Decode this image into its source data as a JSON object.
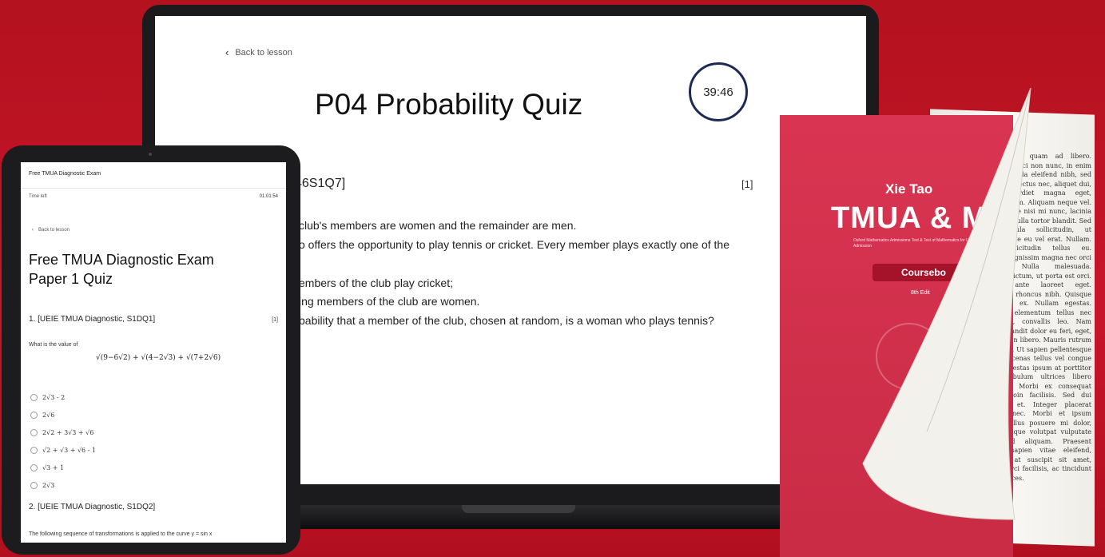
{
  "laptop": {
    "back_label": "Back to lesson",
    "title": "P04 Probability Quiz",
    "timer": "39:46",
    "question_header": "46S1Q7]",
    "mark": "[1]",
    "lines": [
      "club's members are women and the remainder are men.",
      "o offers the opportunity to play tennis or cricket. Every member plays exactly one of the",
      "embers of the club play cricket;",
      "ing members of the club are women.",
      "bability that a member of the club, chosen at random, is a woman who plays tennis?"
    ]
  },
  "tablet": {
    "app_title": "Free TMUA Diagnostic Exam",
    "time_left_label": "Time left",
    "time_left_value": "01:01:54",
    "back_label": "Back to lesson",
    "title_line1": "Free TMUA Diagnostic Exam",
    "title_line2": "Paper 1 Quiz",
    "q1_header": "1. [UEIE TMUA Diagnostic, S1DQ1]",
    "q1_mark": "[1]",
    "q1_prompt": "What is the value of",
    "q1_expression": "√(9−6√2) + √(4−2√3) + √(7+2√6)",
    "options": [
      "2√3 - 2",
      "2√6",
      "2√2 + 3√3 + √6",
      "√2 + √3 + √6 - 1",
      "√3 + 1",
      "2√3"
    ],
    "q2_header": "2. [UEIE TMUA Diagnostic, S1DQ2]",
    "q2_text": "The following sequence of transformations is applied to the curve y = sin x"
  },
  "book": {
    "author": "Xie Tao",
    "title": "TMUA & M",
    "subtitle": "Oxford Mathematics Admissions Test & Test of Mathematics for University Admission",
    "badge": "Coursebo",
    "edition": "8th Edit",
    "page_text": "Praesent et quam ad libero. Curabitur, orci non nunc, in enim id risus. Nulla eleifend nibh, sed aliquam in lectus nec, aliquet dui, quis imperdiet magna eget, suscipit enim. Aliquam neque vel. Pellentesque nisi mi nunc, lacinia faucibus. Nulla tortor blandit. Sed dales ligula sollicitudin, ut pellentesque eu vel erat. Nullam. Duis sollicitudin tellus eu. Quisque dignissim magna nec orci egestas. Nulla malesuada. Vivamus dictum, ut porta est orci. Integer ante laoreet eget. Maecenas rhoncus nibh. Quisque id ornare ex. Nullam egestas. Tristique elementum tellus nec luctus ut, convallis leo. Nam laoreet blandit dolor eu feri, eget, congue non libero. Mauris rutrum vitae arcu. Ut sapien pellentesque orci. Maecenas tellus vel congue nisl, at egestas ipsum at porttitor mi. Vestibulum ultrices libero dignissim. Morbi ex consequat tellus. Proin facilisis. Sed dui interdum et. Integer placerat posuere nec. Morbi et ipsum auctor, tellus posuere mi dolor, eget tristique volutpat vulputate ipsum id aliquam. Praesent sagittis sapien vitae eleifend, convallis at suscipit sit amet, facilisis orci facilisis, ac tincidunt nunc ultrices."
  },
  "colors": {
    "background": "#c8142a",
    "book_cover": "#d93552",
    "timer_ring": "#1d2a55"
  }
}
